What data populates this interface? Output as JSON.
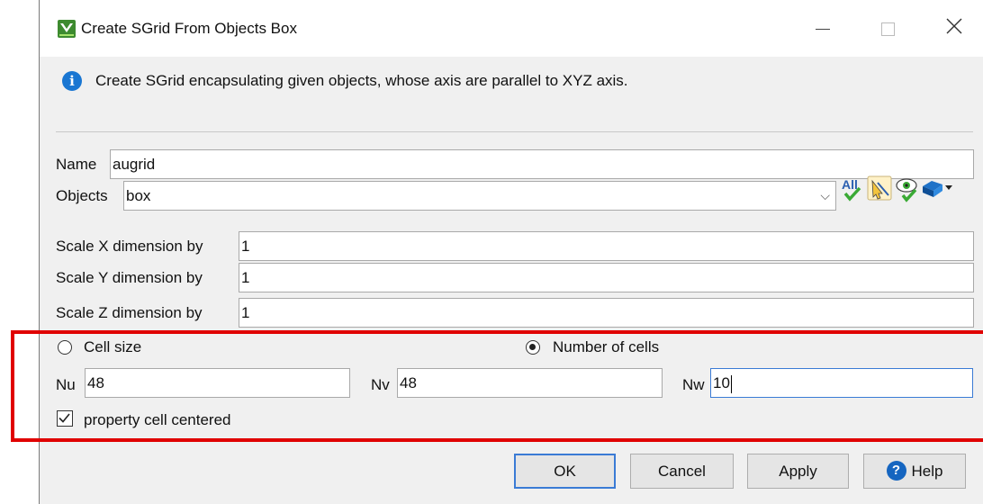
{
  "window": {
    "title": "Create SGrid From Objects Box",
    "minimize_label": "minimize",
    "maximize_label": "maximize",
    "close_label": "close"
  },
  "info": {
    "text": "Create SGrid encapsulating given objects, whose axis are parallel to XYZ axis."
  },
  "form": {
    "name_label": "Name",
    "name_value": "augrid",
    "objects_label": "Objects",
    "objects_value": "box",
    "all_button_label": "All",
    "scale_x_label": "Scale X dimension by",
    "scale_x_value": "1",
    "scale_y_label": "Scale Y dimension by",
    "scale_y_value": "1",
    "scale_z_label": "Scale Z dimension by",
    "scale_z_value": "1"
  },
  "cells": {
    "mode_cell_size_label": "Cell size",
    "mode_number_label": "Number of cells",
    "selected_mode": "Number of cells",
    "nu_label": "Nu",
    "nu_value": "48",
    "nv_label": "Nv",
    "nv_value": "48",
    "nw_label": "Nw",
    "nw_value": "10",
    "centered_label": "property cell centered",
    "centered_checked": true
  },
  "buttons": {
    "ok": "OK",
    "cancel": "Cancel",
    "apply": "Apply",
    "help": "Help"
  },
  "colors": {
    "highlight": "#e00000",
    "info_icon": "#1976d2",
    "focus_border": "#3a7bd5"
  }
}
